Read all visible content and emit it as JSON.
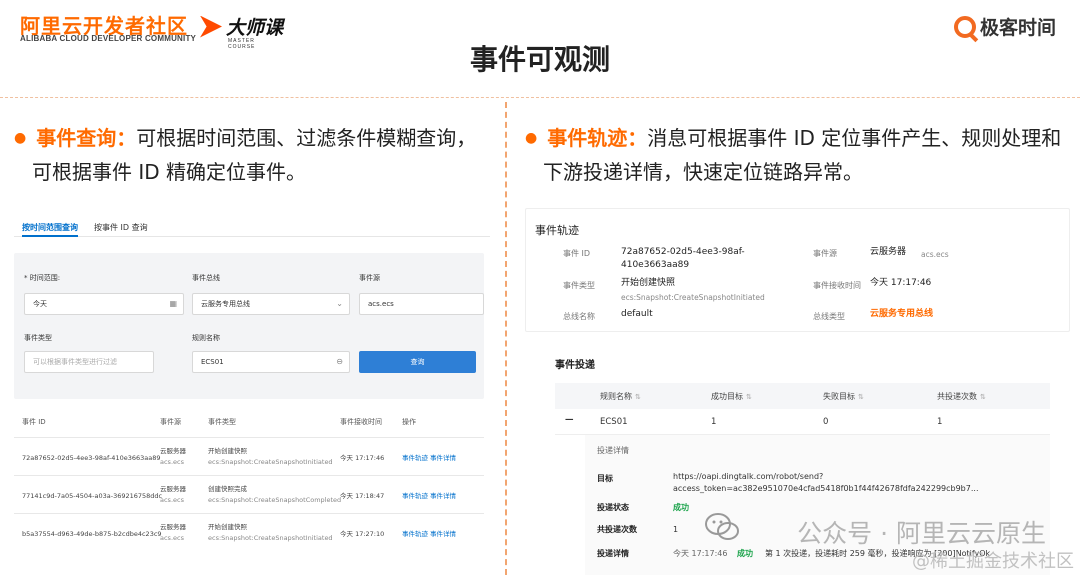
{
  "header": {
    "aliyun_cn": "阿里云开发者社区",
    "aliyun_en": "ALIBABA CLOUD DEVELOPER COMMUNITY",
    "master_cn": "大师课",
    "master_en": "MASTER COURSE",
    "geek": "极客时间",
    "title": "事件可观测"
  },
  "left_bullet": {
    "key": "事件查询：",
    "line1": "可根据时间范围、过滤条件模糊查询，",
    "line2": "可根据事件 ID 精确定位事件。"
  },
  "right_bullet": {
    "key": "事件轨迹：",
    "line1": "消息可根据事件 ID 定位事件产生、规则处理和",
    "line2": "下游投递详情，快速定位链路异常。"
  },
  "query_panel": {
    "tabs": [
      "按时间范围查询",
      "按事件 ID 查询"
    ],
    "filters": {
      "time_label": "* 时间范围:",
      "time_value": "今天",
      "bus_label": "事件总线",
      "bus_value": "云服务专用总线",
      "source_label": "事件源",
      "source_value": "acs.ecs",
      "type_label": "事件类型",
      "type_placeholder": "可以根据事件类型进行过滤",
      "rule_label": "规则名称",
      "rule_value": "ECS01",
      "query_button": "查询"
    },
    "columns": [
      "事件 ID",
      "事件源",
      "事件类型",
      "事件接收时间",
      "操作"
    ],
    "rows": [
      {
        "id": "72a87652-02d5-4ee3-98af-410e3663aa89",
        "source": "云服务器",
        "source_sub": "acs.ecs",
        "type": "开始创建快照",
        "type_sub": "ecs:Snapshot:CreateSnapshotInitiated",
        "time": "今天 17:17:46",
        "action1": "事件轨迹",
        "action2": "事件详情"
      },
      {
        "id": "77141c9d-7a05-4504-a03a-369216758ddc",
        "source": "云服务器",
        "source_sub": "acs.ecs",
        "type": "创建快照完成",
        "type_sub": "ecs:Snapshot:CreateSnapshotCompleted",
        "time": "今天 17:18:47",
        "action1": "事件轨迹",
        "action2": "事件详情"
      },
      {
        "id": "b5a37554-d963-49de-b875-b2cdbe4c23c9",
        "source": "云服务器",
        "source_sub": "acs.ecs",
        "type": "开始创建快照",
        "type_sub": "ecs:Snapshot:CreateSnapshotInitiated",
        "time": "今天 17:27:10",
        "action1": "事件轨迹",
        "action2": "事件详情"
      }
    ]
  },
  "trace_panel": {
    "title": "事件轨迹",
    "event_id_label": "事件 ID",
    "event_id_line1": "72a87652-02d5-4ee3-98af-",
    "event_id_line2": "410e3663aa89",
    "source_label": "事件源",
    "source_value": "云服务器",
    "source_sub": "acs.ecs",
    "type_label": "事件类型",
    "type_value": "开始创建快照",
    "type_sub": "ecs:Snapshot:CreateSnapshotInitiated",
    "recv_label": "事件接收时间",
    "recv_value": "今天 17:17:46",
    "bus_label": "总线名称",
    "bus_value": "default",
    "bus_type_label": "总线类型",
    "bus_type_value": "云服务专用总线",
    "delivery_title": "事件投递",
    "columns": [
      "规则名称",
      "成功目标",
      "失败目标",
      "共投递次数"
    ],
    "row": {
      "expander": "—",
      "rule": "ECS01",
      "success": "1",
      "fail": "0",
      "total": "1"
    },
    "detail": {
      "title": "投递详情",
      "target_label": "目标",
      "target_line1": "https://oapi.dingtalk.com/robot/send?",
      "target_line2": "access_token=ac382e951070e4cfad5418f0b1f44f42678fdfa242299cb9b7...",
      "status_label": "投递状态",
      "status_value": "成功",
      "count_label": "共投递次数",
      "count_value": "1",
      "info_label": "投递详情",
      "info_time": "今天 17:17:46",
      "info_status": "成功",
      "info_text": "第 1 次投递，投递耗时 259 毫秒，投递响应为 [200]NotifyOk"
    }
  },
  "watermark": {
    "text": "公众号 · 阿里云云原生",
    "site": "@稀土掘金技术社区"
  },
  "colors": {
    "accent": "#ff6a00",
    "link": "#0070cc",
    "button": "#2e7fd6",
    "success": "#1aa34a"
  }
}
